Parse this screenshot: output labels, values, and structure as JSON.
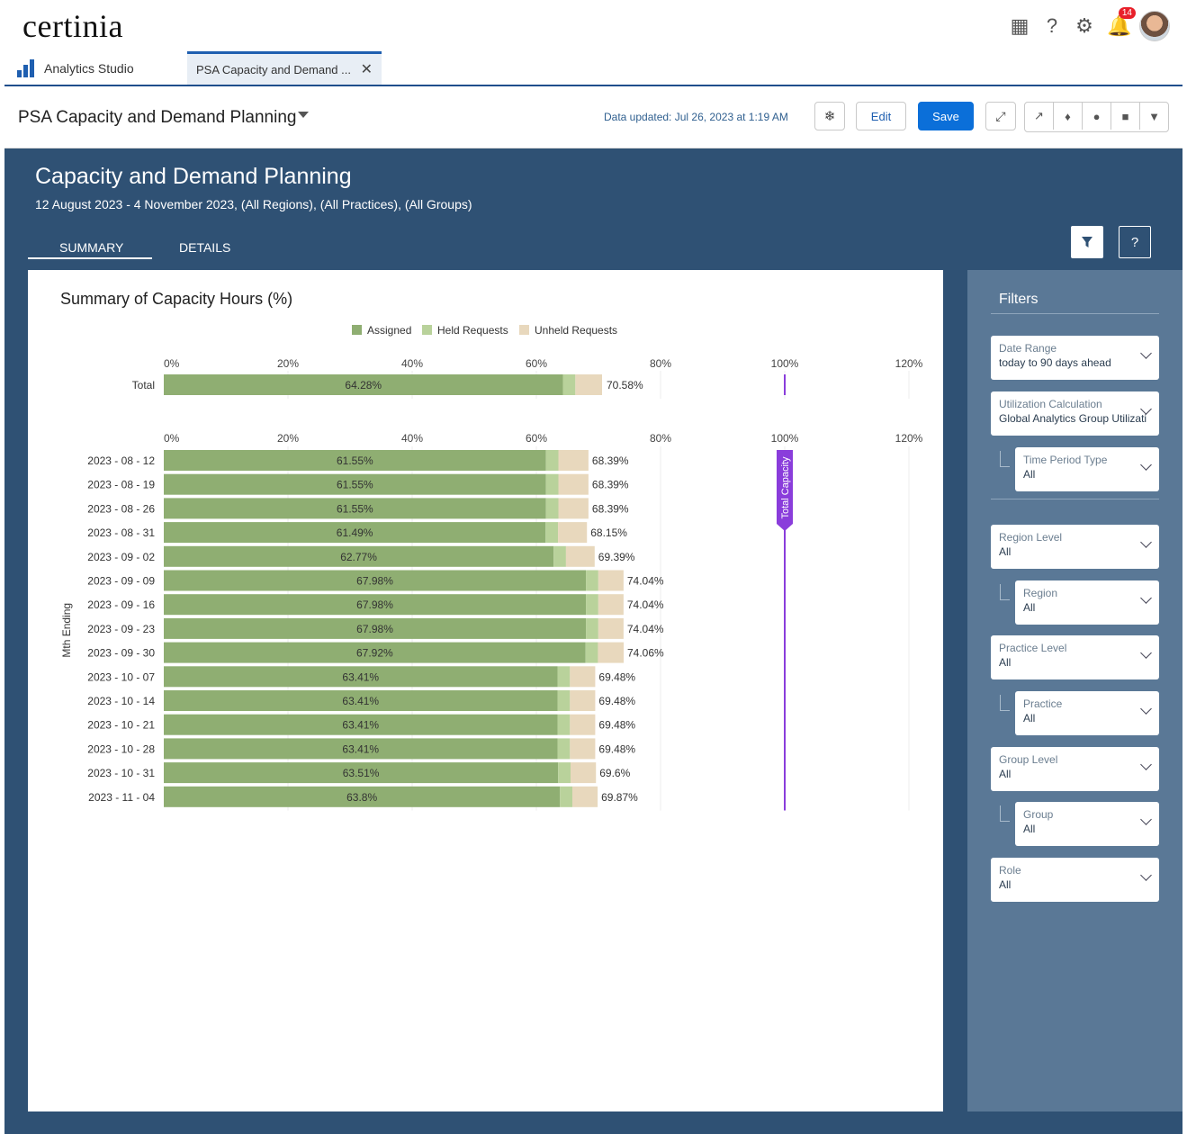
{
  "brand": {
    "logo": "certinia"
  },
  "topbar": {
    "notification_count": "14"
  },
  "tabs": {
    "app_label": "Analytics Studio",
    "doc_label": "PSA Capacity and Demand ..."
  },
  "header": {
    "title": "PSA Capacity and Demand Planning",
    "updated": "Data updated: Jul 26, 2023 at 1:19 AM",
    "edit_label": "Edit",
    "save_label": "Save"
  },
  "dashboard": {
    "title": "Capacity and Demand Planning",
    "subtitle": "12 August 2023 - 4 November 2023, (All Regions), (All Practices), (All Groups)",
    "tab_summary": "SUMMARY",
    "tab_details": "DETAILS",
    "help_label": "?"
  },
  "filters": {
    "title": "Filters",
    "items": [
      {
        "label": "Date Range",
        "value": "today to 90 days ahead"
      },
      {
        "label": "Utilization Calculation",
        "value": "Global Analytics Group Utilizati"
      },
      {
        "label": "Time Period Type",
        "value": "All"
      },
      {
        "label": "Region Level",
        "value": "All"
      },
      {
        "label": "Region",
        "value": "All"
      },
      {
        "label": "Practice Level",
        "value": "All"
      },
      {
        "label": "Practice",
        "value": "All"
      },
      {
        "label": "Group Level",
        "value": "All"
      },
      {
        "label": "Group",
        "value": "All"
      },
      {
        "label": "Role",
        "value": "All"
      }
    ]
  },
  "colors": {
    "assigned": "#8fae72",
    "held": "#b9d29b",
    "unheld": "#e8d8bd",
    "capacity": "#8a3ddb"
  },
  "chart_data": {
    "type": "bar",
    "orientation": "horizontal",
    "stacked": true,
    "title": "Summary of Capacity Hours (%)",
    "legend": [
      "Assigned",
      "Held Requests",
      "Unheld Requests"
    ],
    "legend_position": "top",
    "ylabel": "Mth Ending",
    "xlim": [
      0,
      120
    ],
    "xticks": [
      "0%",
      "20%",
      "40%",
      "60%",
      "80%",
      "100%",
      "120%"
    ],
    "capacity_line": {
      "label": "Total Capacity",
      "value": 100
    },
    "total": {
      "label": "Total",
      "assigned": 64.28,
      "held": 2.0,
      "unheld": 4.3,
      "assigned_label": "64.28%",
      "total_label": "70.58%"
    },
    "categories": [
      "2023 - 08 - 12",
      "2023 - 08 - 19",
      "2023 - 08 - 26",
      "2023 - 08 - 31",
      "2023 - 09 - 02",
      "2023 - 09 - 09",
      "2023 - 09 - 16",
      "2023 - 09 - 23",
      "2023 - 09 - 30",
      "2023 - 10 - 07",
      "2023 - 10 - 14",
      "2023 - 10 - 21",
      "2023 - 10 - 28",
      "2023 - 10 - 31",
      "2023 - 11 - 04"
    ],
    "series": [
      {
        "name": "Assigned",
        "values": [
          61.55,
          61.55,
          61.55,
          61.49,
          62.77,
          67.98,
          67.98,
          67.98,
          67.92,
          63.41,
          63.41,
          63.41,
          63.41,
          63.51,
          63.8
        ]
      },
      {
        "name": "Held Requests",
        "values": [
          2.0,
          2.0,
          2.0,
          2.0,
          2.0,
          2.0,
          2.0,
          2.0,
          2.0,
          2.0,
          2.0,
          2.0,
          2.0,
          2.0,
          2.0
        ]
      },
      {
        "name": "Unheld Requests",
        "values": [
          4.84,
          4.84,
          4.84,
          4.66,
          4.62,
          4.06,
          4.06,
          4.06,
          4.14,
          4.07,
          4.07,
          4.07,
          4.07,
          4.09,
          4.07
        ]
      }
    ],
    "assigned_labels": [
      "61.55%",
      "61.55%",
      "61.55%",
      "61.49%",
      "62.77%",
      "67.98%",
      "67.98%",
      "67.98%",
      "67.92%",
      "63.41%",
      "63.41%",
      "63.41%",
      "63.41%",
      "63.51%",
      "63.8%"
    ],
    "total_labels": [
      "68.39%",
      "68.39%",
      "68.39%",
      "68.15%",
      "69.39%",
      "74.04%",
      "74.04%",
      "74.04%",
      "74.06%",
      "69.48%",
      "69.48%",
      "69.48%",
      "69.48%",
      "69.6%",
      "69.87%"
    ]
  }
}
